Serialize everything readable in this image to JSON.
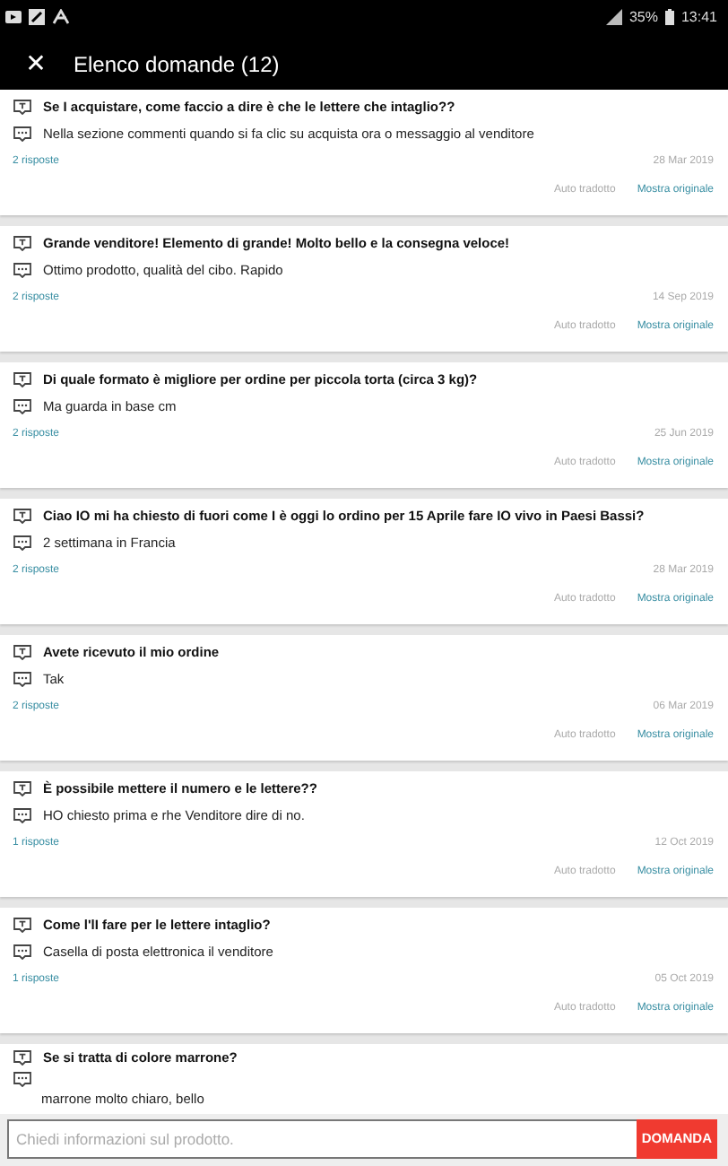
{
  "status_bar": {
    "battery": "35%",
    "time": "13:41"
  },
  "header": {
    "close": "✕",
    "title": "Elenco domande (12)"
  },
  "questions": [
    {
      "kind": "full",
      "question": "Se I acquistare, come faccio a dire è che le lettere che intaglio??",
      "answer": "Nella sezione commenti quando si fa clic su acquista ora o messaggio al venditore",
      "replies": "2 risposte",
      "date": "28 Mar 2019",
      "auto_translated": "Auto tradotto",
      "show_original": "Mostra originale"
    },
    {
      "kind": "full",
      "question": "Grande venditore! Elemento di grande! Molto bello e la consegna veloce!",
      "answer": "Ottimo prodotto, qualità del cibo. Rapido",
      "replies": "2 risposte",
      "date": "14 Sep 2019",
      "auto_translated": "Auto tradotto",
      "show_original": "Mostra originale"
    },
    {
      "kind": "full",
      "question": "Di quale formato è migliore per ordine per piccola torta (circa 3 kg)?",
      "answer": "Ma guarda in base cm",
      "replies": "2 risposte",
      "date": "25 Jun 2019",
      "auto_translated": "Auto tradotto",
      "show_original": "Mostra originale"
    },
    {
      "kind": "full",
      "question": "Ciao IO mi ha chiesto di fuori come I è oggi lo ordino per 15 Aprile fare IO vivo in Paesi Bassi?",
      "answer": "2 settimana in Francia",
      "replies": "2 risposte",
      "date": "28 Mar 2019",
      "auto_translated": "Auto tradotto",
      "show_original": "Mostra originale"
    },
    {
      "kind": "full",
      "question": "Avete ricevuto il mio ordine",
      "answer": "Tak",
      "replies": "2 risposte",
      "date": "06 Mar 2019",
      "auto_translated": "Auto tradotto",
      "show_original": "Mostra originale"
    },
    {
      "kind": "full",
      "question": "È possibile mettere il numero e le lettere??",
      "answer": "HO chiesto prima e rhe Venditore dire di no.",
      "replies": "1 risposte",
      "date": "12 Oct 2019",
      "auto_translated": "Auto tradotto",
      "show_original": "Mostra originale"
    },
    {
      "kind": "full",
      "question": "Come l'lI fare per le lettere intaglio?",
      "answer": "Casella di posta elettronica il venditore",
      "replies": "1 risposte",
      "date": "05 Oct 2019",
      "auto_translated": "Auto tradotto",
      "show_original": "Mostra originale"
    },
    {
      "kind": "cut",
      "question": "Se si tratta di colore marrone?",
      "answer": "marrone molto chiaro, bello"
    }
  ],
  "ask_bar": {
    "placeholder": "Chiedi informazioni sul prodotto.",
    "button": "DOMANDA"
  }
}
